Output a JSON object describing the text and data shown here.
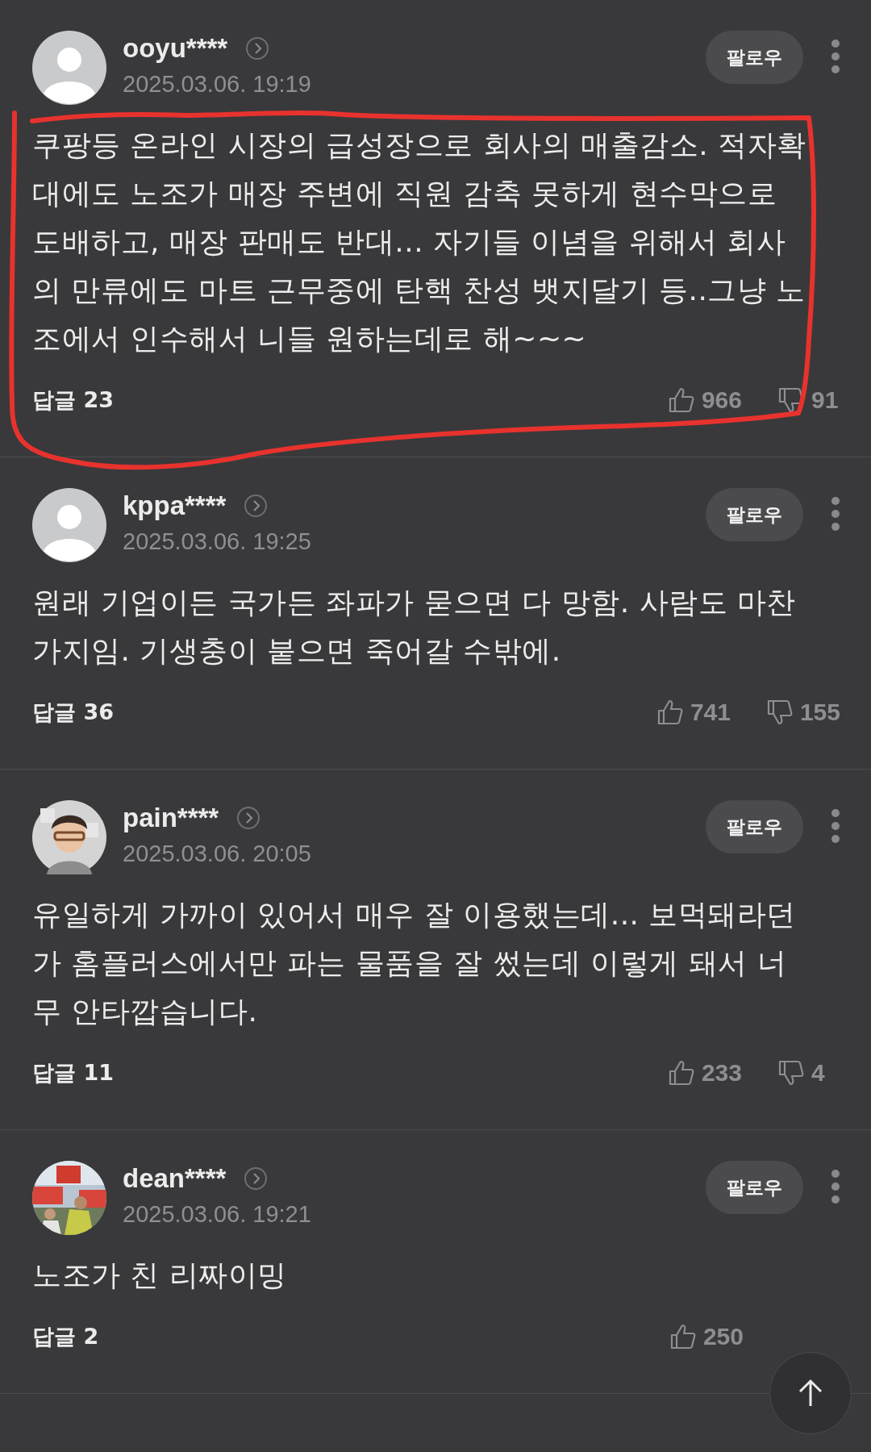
{
  "comments": [
    {
      "avatar": {
        "kind": "default"
      },
      "username": "ooyu****",
      "date": "2025.03.06. 19:19",
      "follow": "팔로우",
      "text": "쿠팡등 온라인 시장의 급성장으로 회사의 매출감소. 적자확대에도 노조가 매장 주변에 직원 감축 못하게 현수막으로 도배하고, 매장 판매도 반대... 자기들 이념을 위해서 회사의 만류에도 마트 근무중에 탄핵 찬성 뱃지달기 등..그냥 노조에서 인수해서 니들 원하는데로 해~~~",
      "replies": "답글 23",
      "likes": "966",
      "dislikes": "91",
      "annotated": true
    },
    {
      "avatar": {
        "kind": "default"
      },
      "username": "kppa****",
      "date": "2025.03.06. 19:25",
      "follow": "팔로우",
      "text": "원래 기업이든 국가든 좌파가 묻으면 다 망함. 사람도 마찬가지임. 기생충이 붙으면 죽어갈 수밖에.",
      "replies": "답글 36",
      "likes": "741",
      "dislikes": "155",
      "annotated": false
    },
    {
      "avatar": {
        "kind": "illustration"
      },
      "username": "pain****",
      "date": "2025.03.06. 20:05",
      "follow": "팔로우",
      "text": "유일하게 가까이 있어서 매우 잘 이용했는데... 보먹돼라던가 홈플러스에서만 파는 물품을 잘 썼는데 이렇게 돼서 너무 안타깝습니다.",
      "replies": "답글 11",
      "likes": "233",
      "dislikes": "4",
      "annotated": false
    },
    {
      "username": "dean****",
      "date": "2025.03.06. 19:21",
      "follow": "팔로우",
      "text": "노조가 친 리짜이밍",
      "replies": "답글 2",
      "likes": "250",
      "annotated": false
    }
  ]
}
